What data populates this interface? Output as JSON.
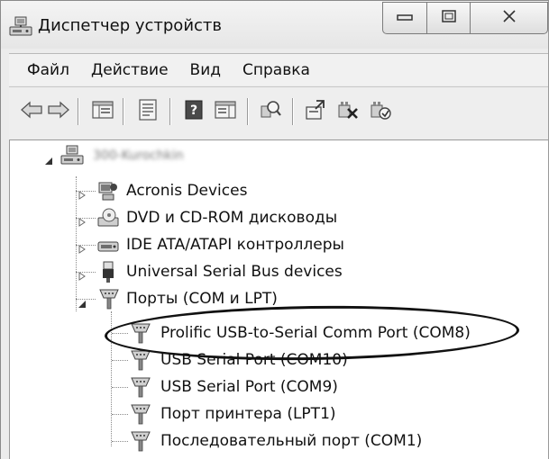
{
  "window": {
    "title": "Диспетчер устройств",
    "title_icon": "device-manager-icon",
    "caption_buttons": [
      "minimize-icon",
      "maximize-icon",
      "close-icon"
    ]
  },
  "menu": {
    "items": [
      "Файл",
      "Действие",
      "Вид",
      "Справка"
    ]
  },
  "toolbar": {
    "buttons": [
      "back-arrow-icon",
      "forward-arrow-icon",
      "show-hide-tree-icon",
      "properties-icon",
      "help-icon",
      "action-pane-icon",
      "scan-hardware-icon",
      "update-driver-icon",
      "disable-device-icon",
      "uninstall-device-icon"
    ]
  },
  "tree": {
    "root": {
      "label": "300-Kurochkin",
      "blurred": true,
      "icon": "computer-icon"
    },
    "categories": [
      {
        "label": "Acronis Devices",
        "icon": "acronis-device-icon",
        "expanded": false
      },
      {
        "label": "DVD и CD-ROM дисководы",
        "icon": "dvd-drive-icon",
        "expanded": false
      },
      {
        "label": "IDE ATA/ATAPI контроллеры",
        "icon": "ide-controller-icon",
        "expanded": false
      },
      {
        "label": "Universal Serial Bus devices",
        "icon": "usb-plug-icon",
        "expanded": false
      },
      {
        "label": "Порты (COM и LPT)",
        "icon": "port-connector-icon",
        "expanded": true
      }
    ],
    "ports": [
      {
        "label": "Prolific USB-to-Serial Comm Port (COM8)",
        "highlighted": true
      },
      {
        "label": "USB Serial Port (COM10)",
        "highlighted": false
      },
      {
        "label": "USB Serial Port (COM9)",
        "highlighted": false
      },
      {
        "label": "Порт принтера (LPT1)",
        "highlighted": false
      },
      {
        "label": "Последовательный порт (COM1)",
        "highlighted": false
      }
    ]
  },
  "colors": {
    "window_bg": "#ececec",
    "tree_bg": "#ffffff",
    "annotation": "#111111"
  }
}
